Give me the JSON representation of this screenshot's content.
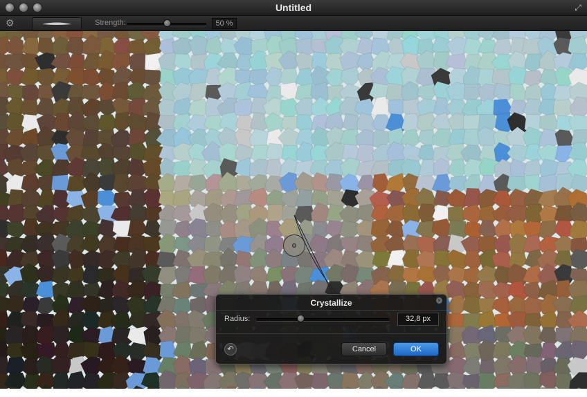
{
  "window": {
    "title": "Untitled"
  },
  "toolbar": {
    "strength_label": "Strength:",
    "strength_value": "50 %",
    "strength_fraction": 0.5
  },
  "filter_dialog": {
    "title": "Crystallize",
    "radius_label": "Radius:",
    "radius_value": "32,8 px",
    "radius_fraction": 0.33,
    "cancel_label": "Cancel",
    "ok_label": "OK"
  },
  "icons": {
    "settings": "gear-icon",
    "fullscreen": "fullscreen-icon",
    "reset": "reset-icon",
    "close": "close-icon"
  },
  "colors": {
    "accent": "#2d7fe0",
    "canvas_sky": "#9fc3cb"
  }
}
